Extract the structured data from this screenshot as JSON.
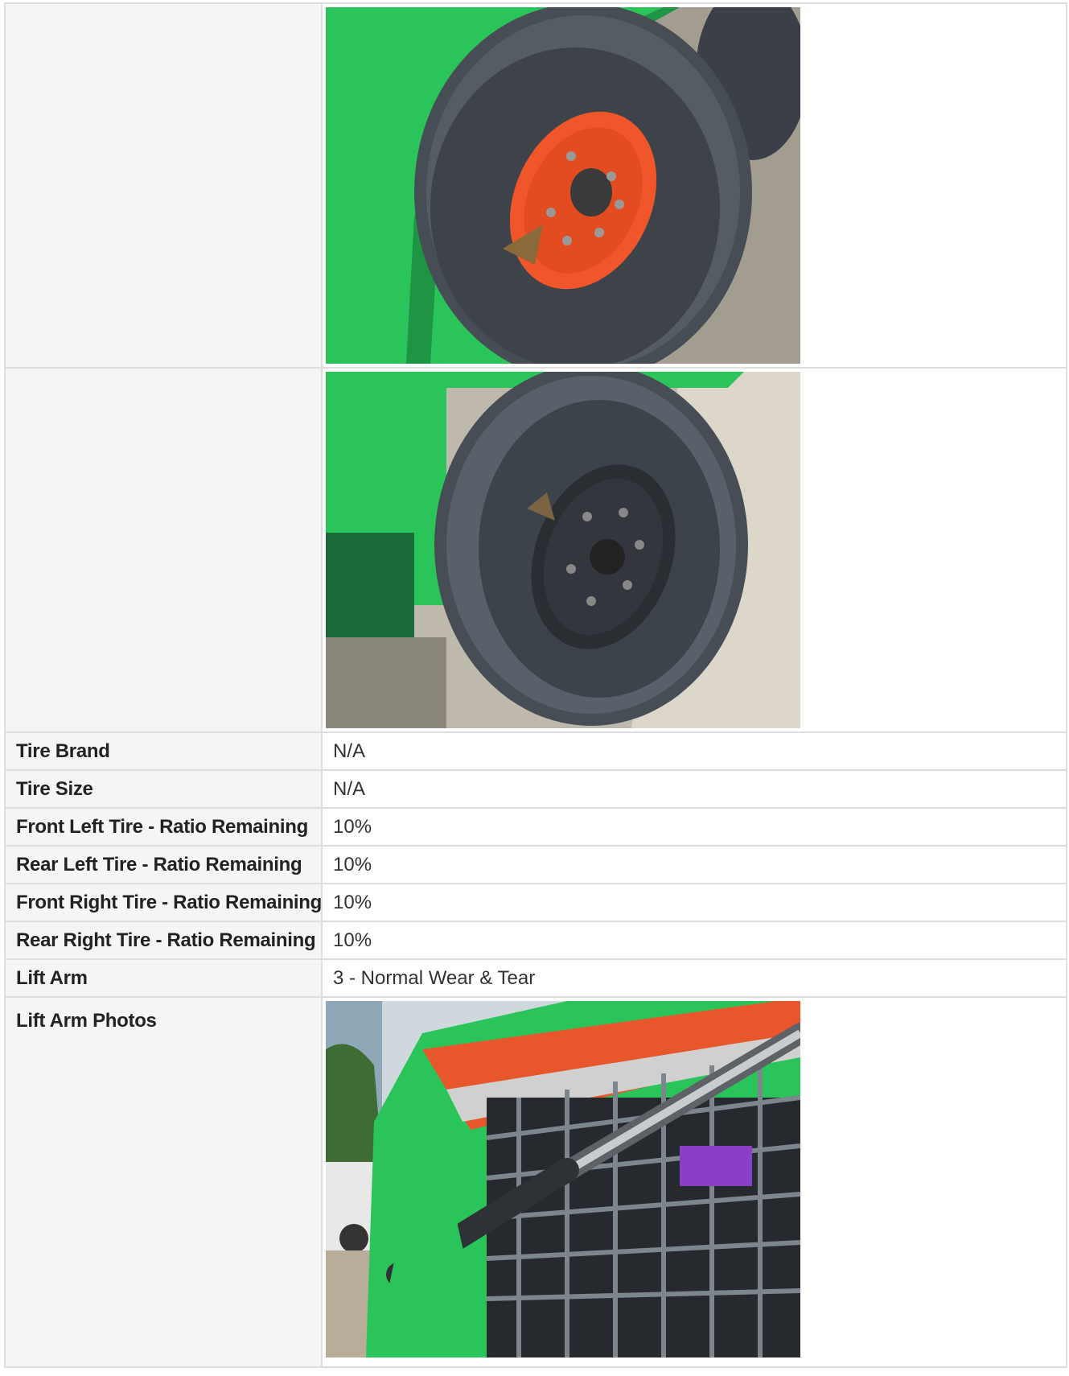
{
  "rows": {
    "tire_brand": {
      "label": "Tire Brand",
      "value": "N/A"
    },
    "tire_size": {
      "label": "Tire Size",
      "value": "N/A"
    },
    "front_left": {
      "label": "Front Left Tire - Ratio Remaining",
      "value": "10%"
    },
    "rear_left": {
      "label": "Rear Left Tire - Ratio Remaining",
      "value": "10%"
    },
    "front_right": {
      "label": "Front Right Tire - Ratio Remaining",
      "value": "10%"
    },
    "rear_right": {
      "label": "Rear Right Tire - Ratio Remaining",
      "value": "10%"
    },
    "lift_arm": {
      "label": "Lift Arm",
      "value": "3 - Normal Wear & Tear"
    },
    "lift_arm_photos": {
      "label": "Lift Arm Photos"
    }
  },
  "colors": {
    "machine_green": "#2bc45a",
    "wheel_orange": "#f0562a",
    "tire_gray": "#4a5058",
    "label_bg": "#f5f5f5",
    "border": "#dedede"
  }
}
